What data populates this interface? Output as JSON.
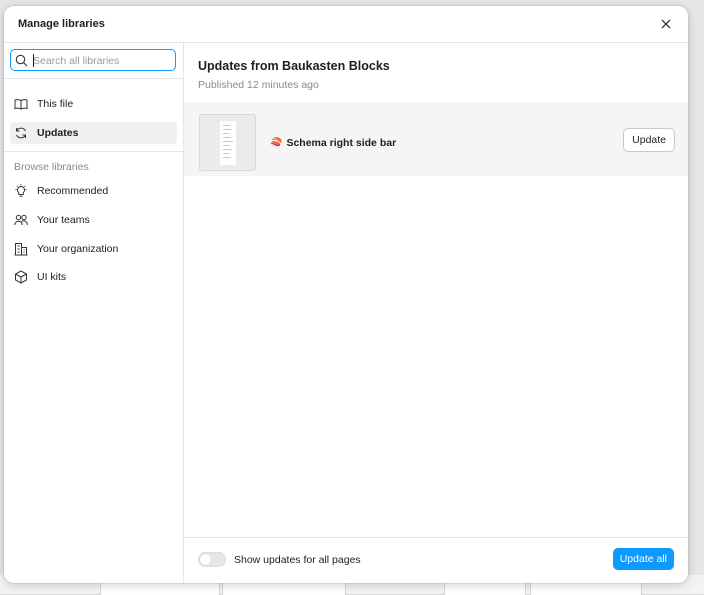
{
  "modal": {
    "title": "Manage libraries"
  },
  "sidebar": {
    "search_placeholder": "Search all libraries",
    "items": [
      {
        "label": "This file",
        "icon": "book-open-icon"
      },
      {
        "label": "Updates",
        "icon": "refresh-icon",
        "active": true
      }
    ],
    "browse_label": "Browse libraries",
    "browse_items": [
      {
        "label": "Recommended",
        "icon": "lightbulb-icon"
      },
      {
        "label": "Your teams",
        "icon": "people-icon"
      },
      {
        "label": "Your organization",
        "icon": "building-icon"
      },
      {
        "label": "UI kits",
        "icon": "cube-icon"
      }
    ]
  },
  "main": {
    "heading": "Updates from Baukasten Blocks",
    "subheading": "Published 12 minutes ago",
    "updates": [
      {
        "emoji": "🍣",
        "name": "Schema right side bar",
        "button": "Update"
      }
    ]
  },
  "footer": {
    "toggle_label": "Show updates for all pages",
    "toggle_on": false,
    "update_all_label": "Update all"
  },
  "colors": {
    "accent": "#0d99ff",
    "row_bg": "#f5f5f5",
    "active_nav_bg": "#f0f0f0"
  }
}
